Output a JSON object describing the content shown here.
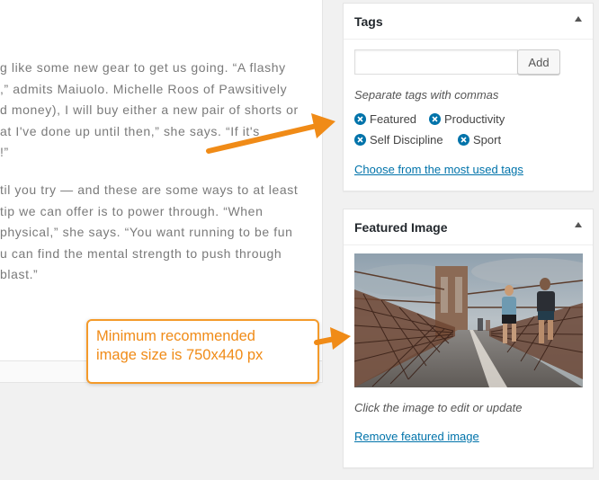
{
  "editor": {
    "paragraph1": [
      "g like some new gear to get us going. “A flashy",
      ",” admits Maiuolo. Michelle Roos of Pawsitively",
      "d money), I will buy either a new pair of shorts or",
      "at I've done up until then,” she says. “If it's",
      "!”"
    ],
    "paragraph2": [
      "til you try — and these are some ways to at least",
      " tip we can offer is to power through. “When",
      "physical,” she says. “You want running to be fun",
      "u can find the mental strength to push through",
      "blast.”"
    ]
  },
  "tags_panel": {
    "title": "Tags",
    "input_value": "",
    "add_label": "Add",
    "hint": "Separate tags with commas",
    "tags": [
      "Featured",
      "Productivity",
      "Self Discipline",
      "Sport"
    ],
    "most_used_link": "Choose from the most used tags"
  },
  "featured_panel": {
    "title": "Featured Image",
    "caption": "Click the image to edit or update",
    "remove_link": "Remove featured image"
  },
  "callout": {
    "text": "Minimum recommended\nimage size is 750x440 px"
  },
  "colors": {
    "accent_link": "#0073aa",
    "callout_orange": "#f08b17"
  }
}
